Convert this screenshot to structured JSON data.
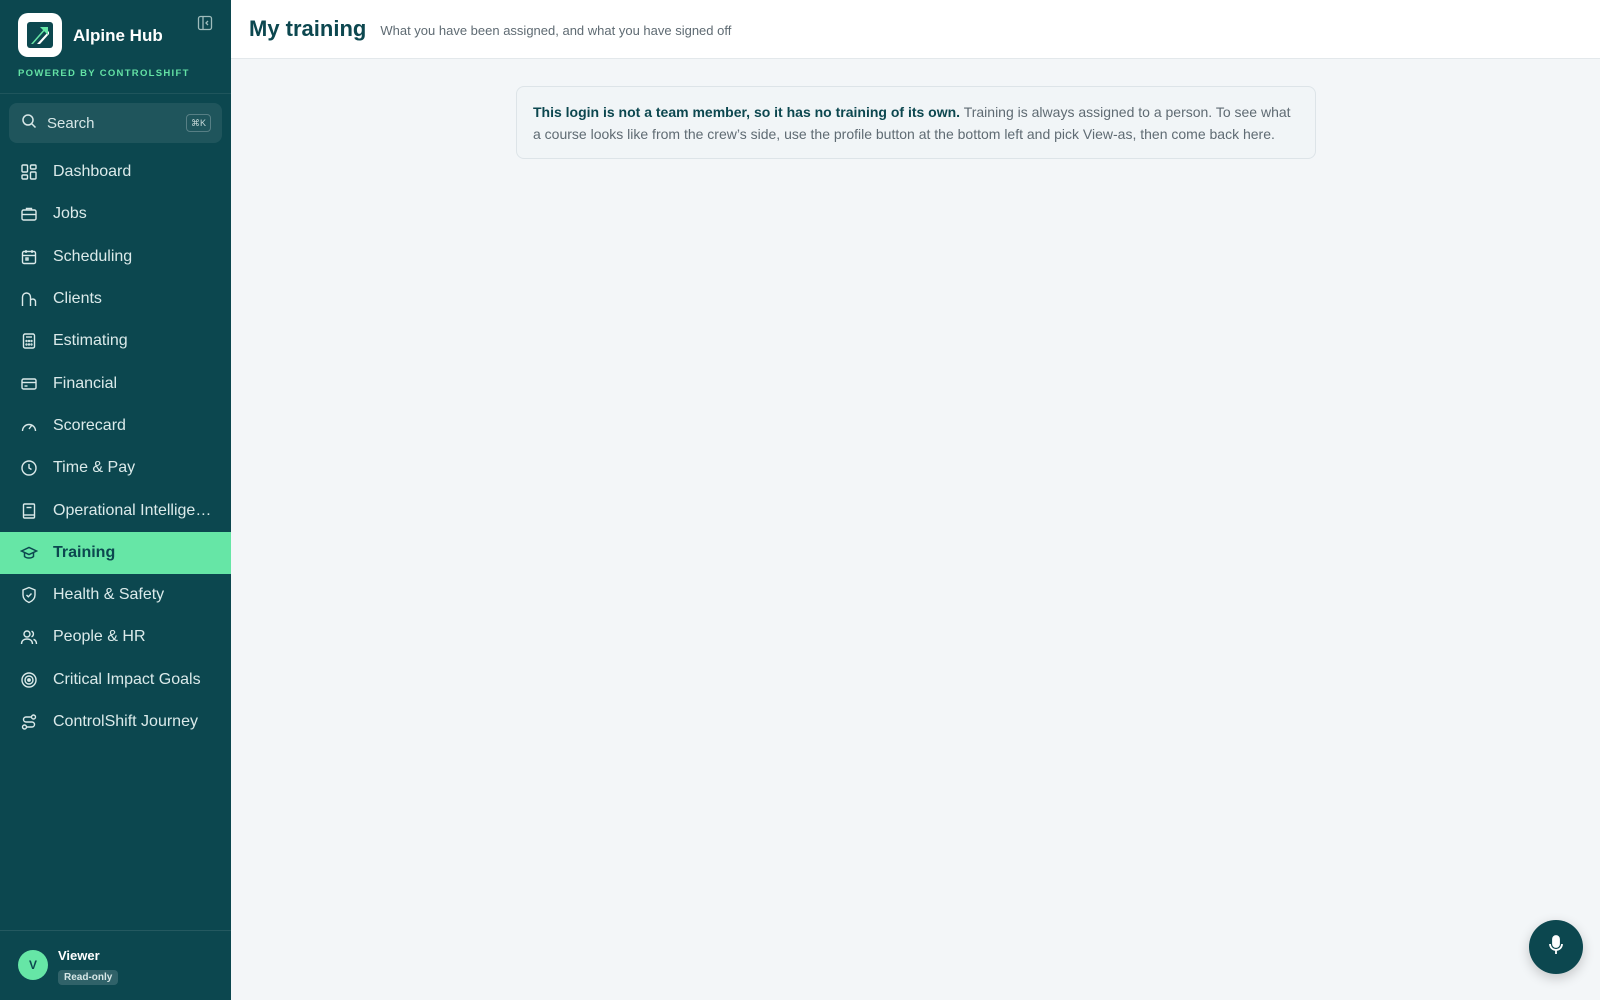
{
  "app": {
    "name": "Alpine Hub",
    "powered_by": "POWERED BY CONTROLSHIFT"
  },
  "search": {
    "label": "Search",
    "shortcut": "⌘K"
  },
  "sidebar": {
    "items": [
      {
        "label": "Dashboard",
        "icon": "dashboard-icon"
      },
      {
        "label": "Jobs",
        "icon": "briefcase-icon"
      },
      {
        "label": "Scheduling",
        "icon": "calendar-icon"
      },
      {
        "label": "Clients",
        "icon": "clients-icon"
      },
      {
        "label": "Estimating",
        "icon": "calculator-icon"
      },
      {
        "label": "Financial",
        "icon": "wallet-icon"
      },
      {
        "label": "Scorecard",
        "icon": "gauge-icon"
      },
      {
        "label": "Time & Pay",
        "icon": "clock-icon"
      },
      {
        "label": "Operational Intellige…",
        "icon": "book-icon"
      },
      {
        "label": "Training",
        "icon": "graduation-cap-icon",
        "active": true
      },
      {
        "label": "Health & Safety",
        "icon": "shield-icon"
      },
      {
        "label": "People & HR",
        "icon": "users-icon"
      },
      {
        "label": "Critical Impact Goals",
        "icon": "target-icon"
      },
      {
        "label": "ControlShift Journey",
        "icon": "route-icon"
      }
    ]
  },
  "user": {
    "initial": "V",
    "name": "Viewer",
    "role": "Read-only"
  },
  "header": {
    "title": "My training",
    "subtitle": "What you have been assigned, and what you have signed off"
  },
  "notice": {
    "bold": "This login is not a team member, so it has no training of its own.",
    "text": " Training is always assigned to a person. To see what a course looks like from the crew’s side, use the profile button at the bottom left and pick View-as, then come back here."
  },
  "colors": {
    "sidebar_bg": "#0c474f",
    "accent": "#66e6a6",
    "page_bg": "#f3f6f8"
  }
}
